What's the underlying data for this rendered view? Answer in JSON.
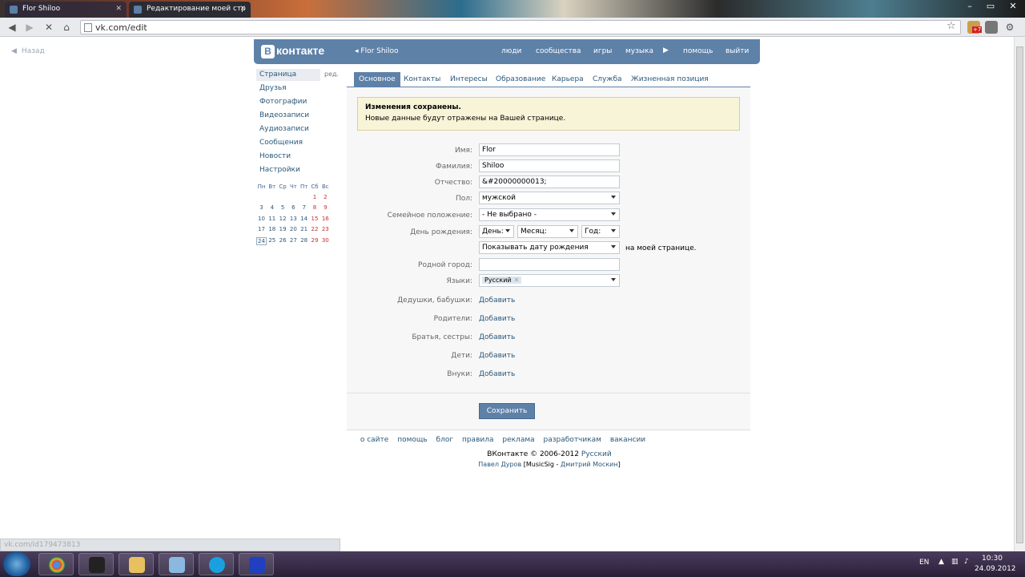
{
  "browser": {
    "tabs": [
      {
        "title": "Flor Shiloo",
        "active": false
      },
      {
        "title": "Редактирование моей стр",
        "active": true
      }
    ],
    "url": "vk.com/edit",
    "status_url": "vk.com/id179473813",
    "extension_badge": "+7"
  },
  "vk": {
    "back_label": "Назад",
    "logo_text": "контакте",
    "logo_letter": "В",
    "user_name": "Flor Shiloo",
    "top_nav": [
      "люди",
      "сообщества",
      "игры",
      "музыка",
      "помощь",
      "выйти"
    ],
    "sidebar": {
      "items": [
        "Страница",
        "Друзья",
        "Фотографии",
        "Видеозаписи",
        "Аудиозаписи",
        "Сообщения",
        "Новости",
        "Настройки"
      ],
      "edit_label": "ред."
    },
    "calendar": {
      "weekdays": [
        "Пн",
        "Вт",
        "Ср",
        "Чт",
        "Пт",
        "Сб",
        "Вс"
      ],
      "weeks": [
        [
          "",
          "",
          "",
          "",
          "",
          "1",
          "2"
        ],
        [
          "3",
          "4",
          "5",
          "6",
          "7",
          "8",
          "9"
        ],
        [
          "10",
          "11",
          "12",
          "13",
          "14",
          "15",
          "16"
        ],
        [
          "17",
          "18",
          "19",
          "20",
          "21",
          "22",
          "23"
        ],
        [
          "24",
          "25",
          "26",
          "27",
          "28",
          "29",
          "30"
        ]
      ],
      "today": "24"
    },
    "tabs": [
      "Основное",
      "Контакты",
      "Интересы",
      "Образование",
      "Карьера",
      "Служба",
      "Жизненная позиция"
    ],
    "notice": {
      "title": "Изменения сохранены.",
      "text": "Новые данные будут отражены на Вашей странице."
    },
    "form": {
      "first_name_label": "Имя:",
      "first_name": "Flor",
      "last_name_label": "Фамилия:",
      "last_name": "Shiloo",
      "patronymic_label": "Отчество:",
      "patronymic": "&#20000000013;",
      "gender_label": "Пол:",
      "gender": "мужской",
      "family_label": "Семейное положение:",
      "family": "- Не выбрано -",
      "birthday_label": "День рождения:",
      "day": "День:",
      "month": "Месяц:",
      "year": "Год:",
      "show_birthday": "Показывать дату рождения",
      "show_birthday_suffix": "на моей странице.",
      "hometown_label": "Родной город:",
      "hometown": "",
      "languages_label": "Языки:",
      "language_tag": "Русский",
      "grandparents_label": "Дедушки, бабушки:",
      "parents_label": "Родители:",
      "siblings_label": "Братья, сестры:",
      "children_label": "Дети:",
      "grandchildren_label": "Внуки:",
      "add_label": "Добавить",
      "save_label": "Сохранить"
    },
    "footer": {
      "links": [
        "о сайте",
        "помощь",
        "блог",
        "правила",
        "реклама",
        "разработчикам",
        "вакансии"
      ],
      "copyright": "ВКонтакте © 2006-2012",
      "language": "Русский",
      "credit_1": "Павел Дуров",
      "credit_mid": "[MusicSig -",
      "credit_2": "Дмитрий Москин",
      "credit_end": "]"
    }
  },
  "taskbar": {
    "lang": "EN",
    "time": "10:30",
    "date": "24.09.2012"
  }
}
